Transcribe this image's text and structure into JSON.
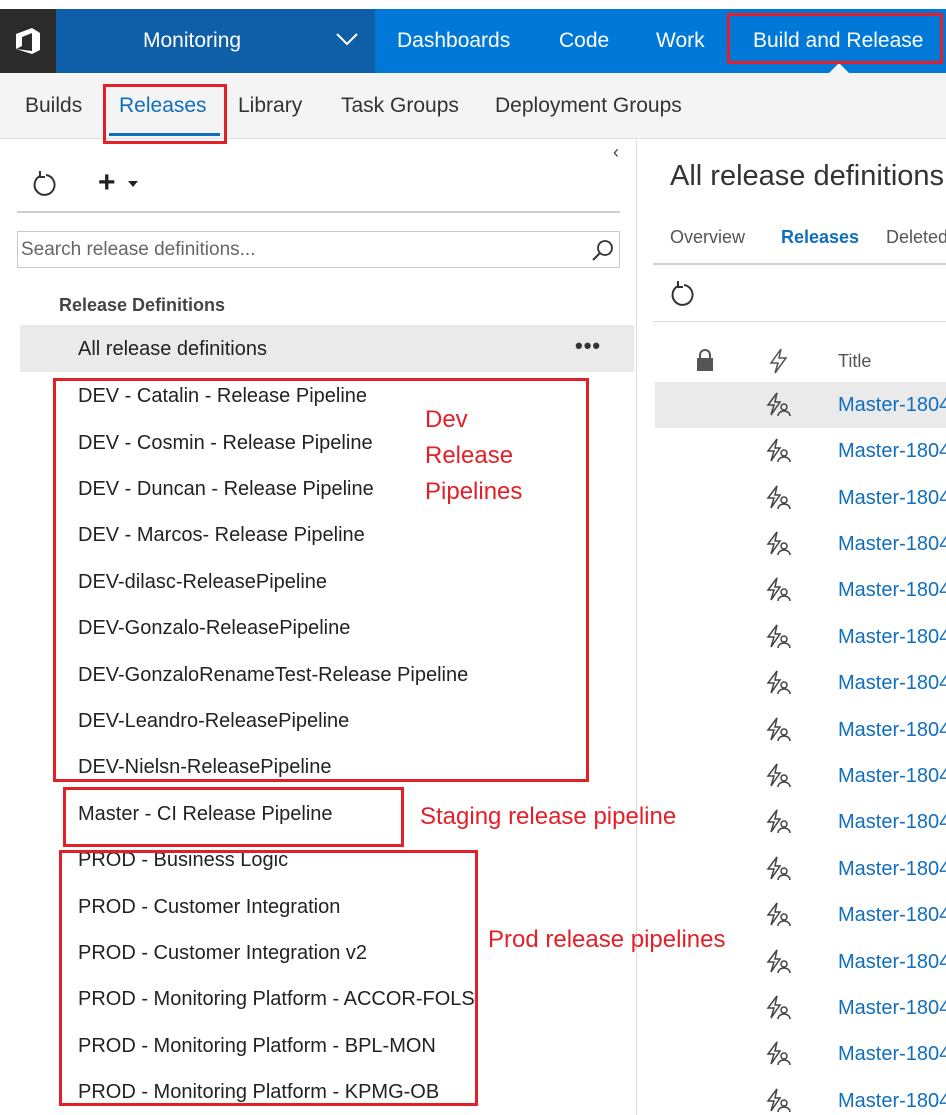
{
  "topnav": {
    "project": "Monitoring",
    "items": [
      "Dashboards",
      "Code",
      "Work",
      "Build and Release"
    ]
  },
  "subnav": {
    "tabs": [
      "Builds",
      "Releases",
      "Library",
      "Task Groups",
      "Deployment Groups"
    ],
    "active": "Releases"
  },
  "left": {
    "search_placeholder": "Search release definitions...",
    "section_header": "Release Definitions",
    "all_label": "All release definitions",
    "more": "•••",
    "definitions": [
      "DEV - Catalin - Release Pipeline",
      "DEV - Cosmin - Release Pipeline",
      "DEV - Duncan - Release Pipeline",
      "DEV - Marcos- Release Pipeline",
      "DEV-dilasc-ReleasePipeline",
      "DEV-Gonzalo-ReleasePipeline",
      "DEV-GonzaloRenameTest-Release Pipeline",
      "DEV-Leandro-ReleasePipeline",
      "DEV-Nielsn-ReleasePipeline",
      "Master - CI Release Pipeline",
      "PROD - Business Logic",
      "PROD - Customer Integration",
      "PROD - Customer Integration v2",
      "PROD - Monitoring Platform - ACCOR-FOLS",
      "PROD - Monitoring Platform - BPL-MON",
      "PROD - Monitoring Platform - KPMG-OB"
    ]
  },
  "right": {
    "title": "All release definitions",
    "tabs": [
      "Overview",
      "Releases",
      "Deleted"
    ],
    "active_tab": "Releases",
    "column_title": "Title",
    "rows": [
      "Master-1804",
      "Master-1804",
      "Master-1804",
      "Master-1804",
      "Master-1804",
      "Master-1804",
      "Master-1804",
      "Master-1804",
      "Master-1804",
      "Master-1804",
      "Master-1804",
      "Master-1804",
      "Master-1804",
      "Master-1804",
      "Master-1804",
      "Master-1804"
    ]
  },
  "annotations": {
    "dev_label": [
      "Dev",
      "Release",
      "Pipelines"
    ],
    "staging_label": "Staging release pipeline",
    "prod_label": "Prod release pipelines"
  },
  "colors": {
    "nav_blue": "#0078d7",
    "project_blue": "#0f5fa8",
    "link_blue": "#106ebe",
    "annotation_red": "#e32027"
  }
}
